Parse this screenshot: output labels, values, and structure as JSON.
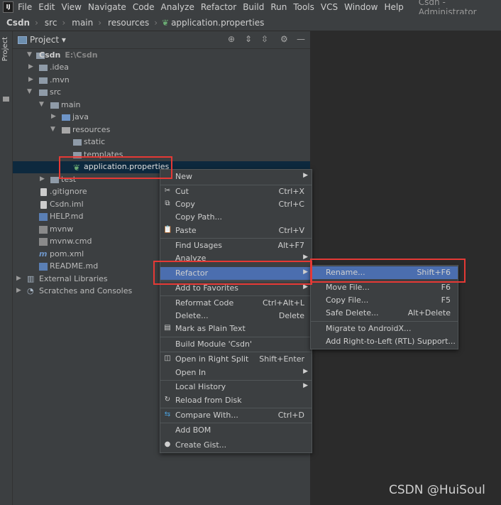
{
  "menubar": {
    "items": [
      "File",
      "Edit",
      "View",
      "Navigate",
      "Code",
      "Analyze",
      "Refactor",
      "Build",
      "Run",
      "Tools",
      "VCS",
      "Window",
      "Help"
    ],
    "window_title": "Csdn - Administrator",
    "logo_text": "IJ"
  },
  "breadcrumb": {
    "items": [
      "Csdn",
      "src",
      "main",
      "resources",
      "application.properties"
    ]
  },
  "toolwindow": {
    "label": "Project"
  },
  "project_panel": {
    "title": "Project",
    "tree": [
      {
        "label": "Csdn",
        "sub": "E:\\Csdn",
        "icon": "folder-icon"
      },
      {
        "label": ".idea",
        "icon": "folder-icon"
      },
      {
        "label": ".mvn",
        "icon": "folder-icon"
      },
      {
        "label": "src",
        "icon": "folder-icon"
      },
      {
        "label": "main",
        "icon": "folder-icon"
      },
      {
        "label": "java",
        "icon": "folder-icon"
      },
      {
        "label": "resources",
        "icon": "folder-icon"
      },
      {
        "label": "static",
        "icon": "folder-icon"
      },
      {
        "label": "templates",
        "icon": "folder-icon"
      },
      {
        "label": "application.properties",
        "icon": "spring-properties-icon"
      },
      {
        "label": "test",
        "icon": "folder-icon"
      },
      {
        "label": ".gitignore",
        "icon": "file-icon"
      },
      {
        "label": "Csdn.iml",
        "icon": "file-icon"
      },
      {
        "label": "HELP.md",
        "icon": "markdown-icon"
      },
      {
        "label": "mvnw",
        "icon": "file-icon"
      },
      {
        "label": "mvnw.cmd",
        "icon": "file-icon"
      },
      {
        "label": "pom.xml",
        "icon": "maven-icon"
      },
      {
        "label": "README.md",
        "icon": "markdown-icon"
      },
      {
        "label": "External Libraries",
        "icon": "libraries-icon"
      },
      {
        "label": "Scratches and Consoles",
        "icon": "scratches-icon"
      }
    ]
  },
  "context_menu": {
    "items": [
      {
        "label": "New",
        "shortcut": "",
        "submenu": true
      },
      {
        "label": "Cut",
        "shortcut": "Ctrl+X",
        "icon": "cut-icon"
      },
      {
        "label": "Copy",
        "shortcut": "Ctrl+C",
        "icon": "copy-icon"
      },
      {
        "label": "Copy Path...",
        "shortcut": ""
      },
      {
        "label": "Paste",
        "shortcut": "Ctrl+V",
        "icon": "paste-icon"
      },
      {
        "label": "Find Usages",
        "shortcut": "Alt+F7"
      },
      {
        "label": "Analyze",
        "shortcut": "",
        "submenu": true
      },
      {
        "label": "Refactor",
        "shortcut": "",
        "submenu": true
      },
      {
        "label": "Add to Favorites",
        "shortcut": "",
        "submenu": true
      },
      {
        "label": "Reformat Code",
        "shortcut": "Ctrl+Alt+L"
      },
      {
        "label": "Delete...",
        "shortcut": "Delete"
      },
      {
        "label": "Mark as Plain Text",
        "shortcut": "",
        "icon": "plain-text-icon"
      },
      {
        "label": "Build Module 'Csdn'",
        "shortcut": ""
      },
      {
        "label": "Open in Right Split",
        "shortcut": "Shift+Enter",
        "icon": "split-icon"
      },
      {
        "label": "Open In",
        "shortcut": "",
        "submenu": true
      },
      {
        "label": "Local History",
        "shortcut": "",
        "submenu": true
      },
      {
        "label": "Reload from Disk",
        "shortcut": "",
        "icon": "reload-icon"
      },
      {
        "label": "Compare With...",
        "shortcut": "Ctrl+D",
        "icon": "compare-icon"
      },
      {
        "label": "Add BOM",
        "shortcut": ""
      },
      {
        "label": "Create Gist...",
        "shortcut": "",
        "icon": "github-icon"
      }
    ]
  },
  "refactor_submenu": {
    "items": [
      {
        "label": "Rename...",
        "shortcut": "Shift+F6"
      },
      {
        "label": "Move File...",
        "shortcut": "F6"
      },
      {
        "label": "Copy File...",
        "shortcut": "F5"
      },
      {
        "label": "Safe Delete...",
        "shortcut": "Alt+Delete"
      },
      {
        "label": "Migrate to AndroidX...",
        "shortcut": ""
      },
      {
        "label": "Add Right-to-Left (RTL) Support...",
        "shortcut": ""
      }
    ]
  },
  "watermark": "CSDN @HuiSoul",
  "colors": {
    "highlight": "#4b6eaf",
    "annotation": "#e53935",
    "panel": "#3c3f41",
    "editor": "#2b2b2b"
  }
}
